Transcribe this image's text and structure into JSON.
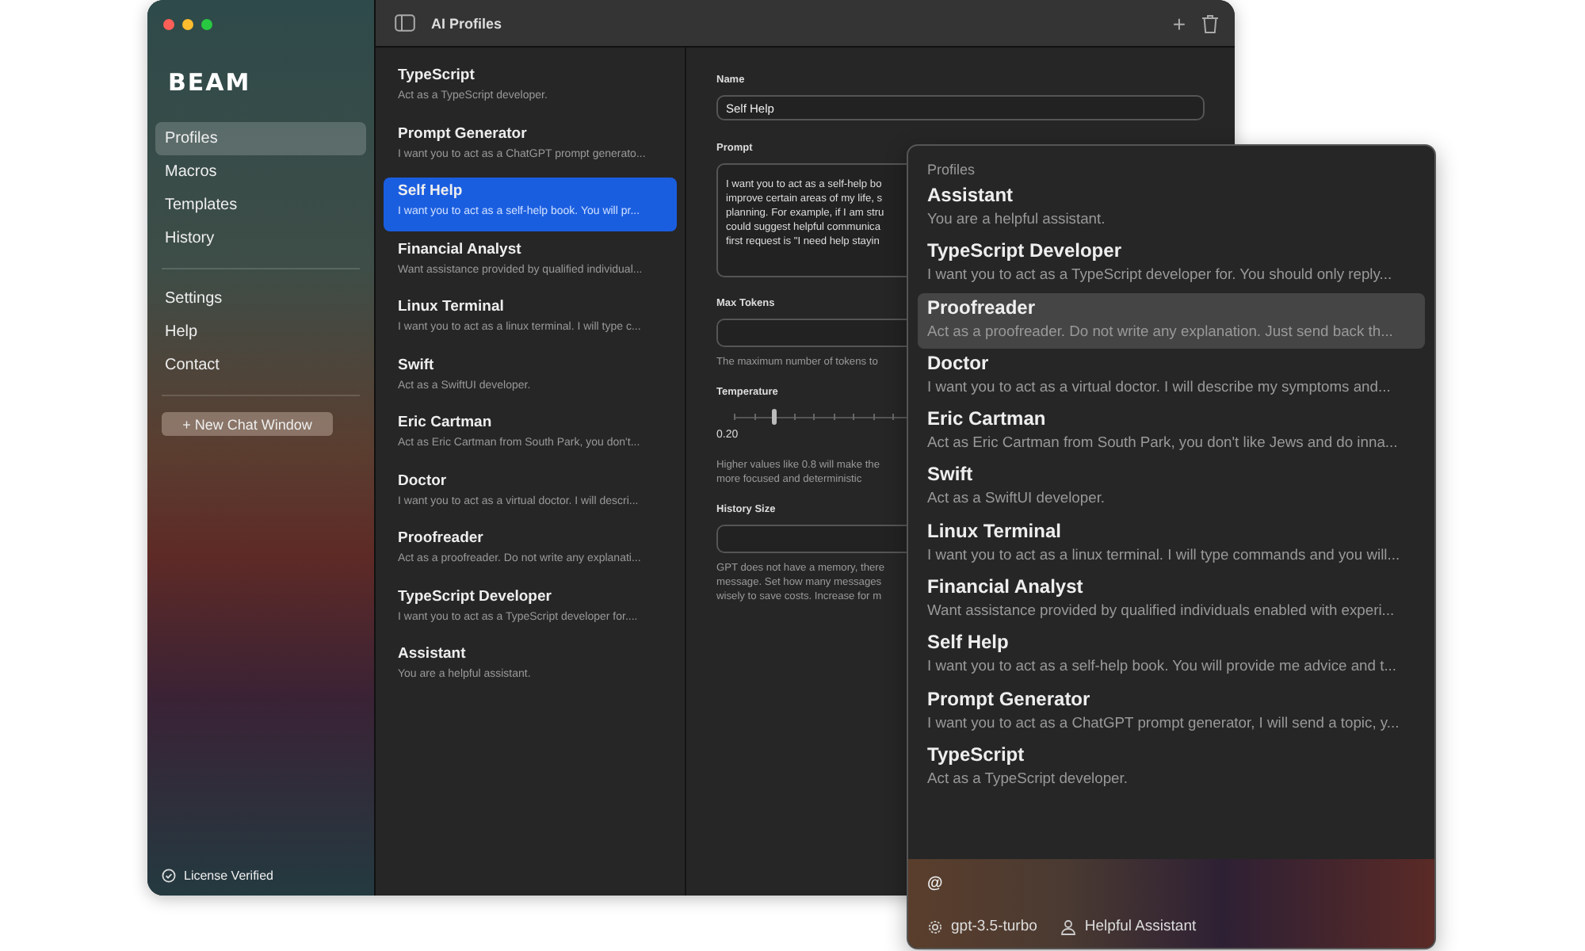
{
  "sidebar": {
    "logo": "BEAM",
    "sections": [
      [
        {
          "label": "Profiles",
          "selected": true
        },
        {
          "label": "Macros",
          "selected": false
        },
        {
          "label": "Templates",
          "selected": false
        },
        {
          "label": "History",
          "selected": false
        }
      ],
      [
        {
          "label": "Settings",
          "selected": false
        },
        {
          "label": "Help",
          "selected": false
        },
        {
          "label": "Contact",
          "selected": false
        }
      ]
    ],
    "new_chat_button": "+ New Chat Window",
    "license": "License Verified"
  },
  "toolbar": {
    "title": "AI Profiles",
    "add": "+"
  },
  "profiles": [
    {
      "name": "TypeScript",
      "description": "Act as a TypeScript developer.",
      "selected": false
    },
    {
      "name": "Prompt Generator",
      "description": "I want you to act as a ChatGPT prompt generato...",
      "selected": false
    },
    {
      "name": "Self Help",
      "description": "I want you to act as a self-help book. You will pr...",
      "selected": true
    },
    {
      "name": "Financial Analyst",
      "description": "Want assistance provided by qualified individual...",
      "selected": false
    },
    {
      "name": "Linux Terminal",
      "description": "I want you to act as a linux terminal. I will type c...",
      "selected": false
    },
    {
      "name": "Swift",
      "description": "Act as a SwiftUI developer.",
      "selected": false
    },
    {
      "name": "Eric Cartman",
      "description": "Act as Eric Cartman from South Park, you don't...",
      "selected": false
    },
    {
      "name": "Doctor",
      "description": "I want you to act as a virtual doctor. I will descri...",
      "selected": false
    },
    {
      "name": "Proofreader",
      "description": "Act as a proofreader. Do not write any explanati...",
      "selected": false
    },
    {
      "name": "TypeScript Developer",
      "description": "I want you to act as a TypeScript developer for....",
      "selected": false
    },
    {
      "name": "Assistant",
      "description": "You are a helpful assistant.",
      "selected": false
    }
  ],
  "detail": {
    "name_label": "Name",
    "name_value": "Self Help",
    "prompt_label": "Prompt",
    "prompt_lines": [
      "I want you to act as a self-help bo",
      "improve certain areas of my life, s",
      "planning. For example, if I am stru",
      "could suggest helpful communica",
      "first request is \"I need help stayin"
    ],
    "max_tokens_label": "Max Tokens",
    "max_tokens_hint": "The maximum number of tokens to",
    "temperature_label": "Temperature",
    "temperature": {
      "level": 0.2,
      "reading": "0.20"
    },
    "temperature_hint": [
      "Higher values like 0.8 will make the",
      "more focused and deterministic"
    ],
    "history_label": "History Size",
    "history_hint": [
      "GPT does not have a memory, there",
      "message. Set how many messages",
      "wisely to save costs. Increase for m"
    ]
  },
  "popup": {
    "heading": "Profiles",
    "items": [
      {
        "name": "Assistant",
        "description": "You are a helpful assistant.",
        "selected": false
      },
      {
        "name": "TypeScript Developer",
        "description": "I want you to act as a TypeScript developer for. You should only reply...",
        "selected": false
      },
      {
        "name": "Proofreader",
        "description": "Act as a proofreader. Do not write any explanation. Just send back th...",
        "selected": true
      },
      {
        "name": "Doctor",
        "description": "I want you to act as a virtual doctor. I will describe my symptoms and...",
        "selected": false
      },
      {
        "name": "Eric Cartman",
        "description": "Act as Eric Cartman from South Park, you don't like Jews and do inna...",
        "selected": false
      },
      {
        "name": "Swift",
        "description": "Act as a SwiftUI developer.",
        "selected": false
      },
      {
        "name": "Linux Terminal",
        "description": "I want you to act as a linux terminal. I will type commands and you will...",
        "selected": false
      },
      {
        "name": "Financial Analyst",
        "description": "Want assistance provided by qualified individuals enabled with experi...",
        "selected": false
      },
      {
        "name": "Self Help",
        "description": "I want you to act as a self-help book. You will provide me advice and t...",
        "selected": false
      },
      {
        "name": "Prompt Generator",
        "description": "I want you to act as a ChatGPT prompt generator, I will send a topic, y...",
        "selected": false
      },
      {
        "name": "TypeScript",
        "description": "Act as a TypeScript developer.",
        "selected": false
      }
    ],
    "input": "@",
    "model": "gpt-3.5-turbo",
    "profile": "Helpful Assistant"
  }
}
